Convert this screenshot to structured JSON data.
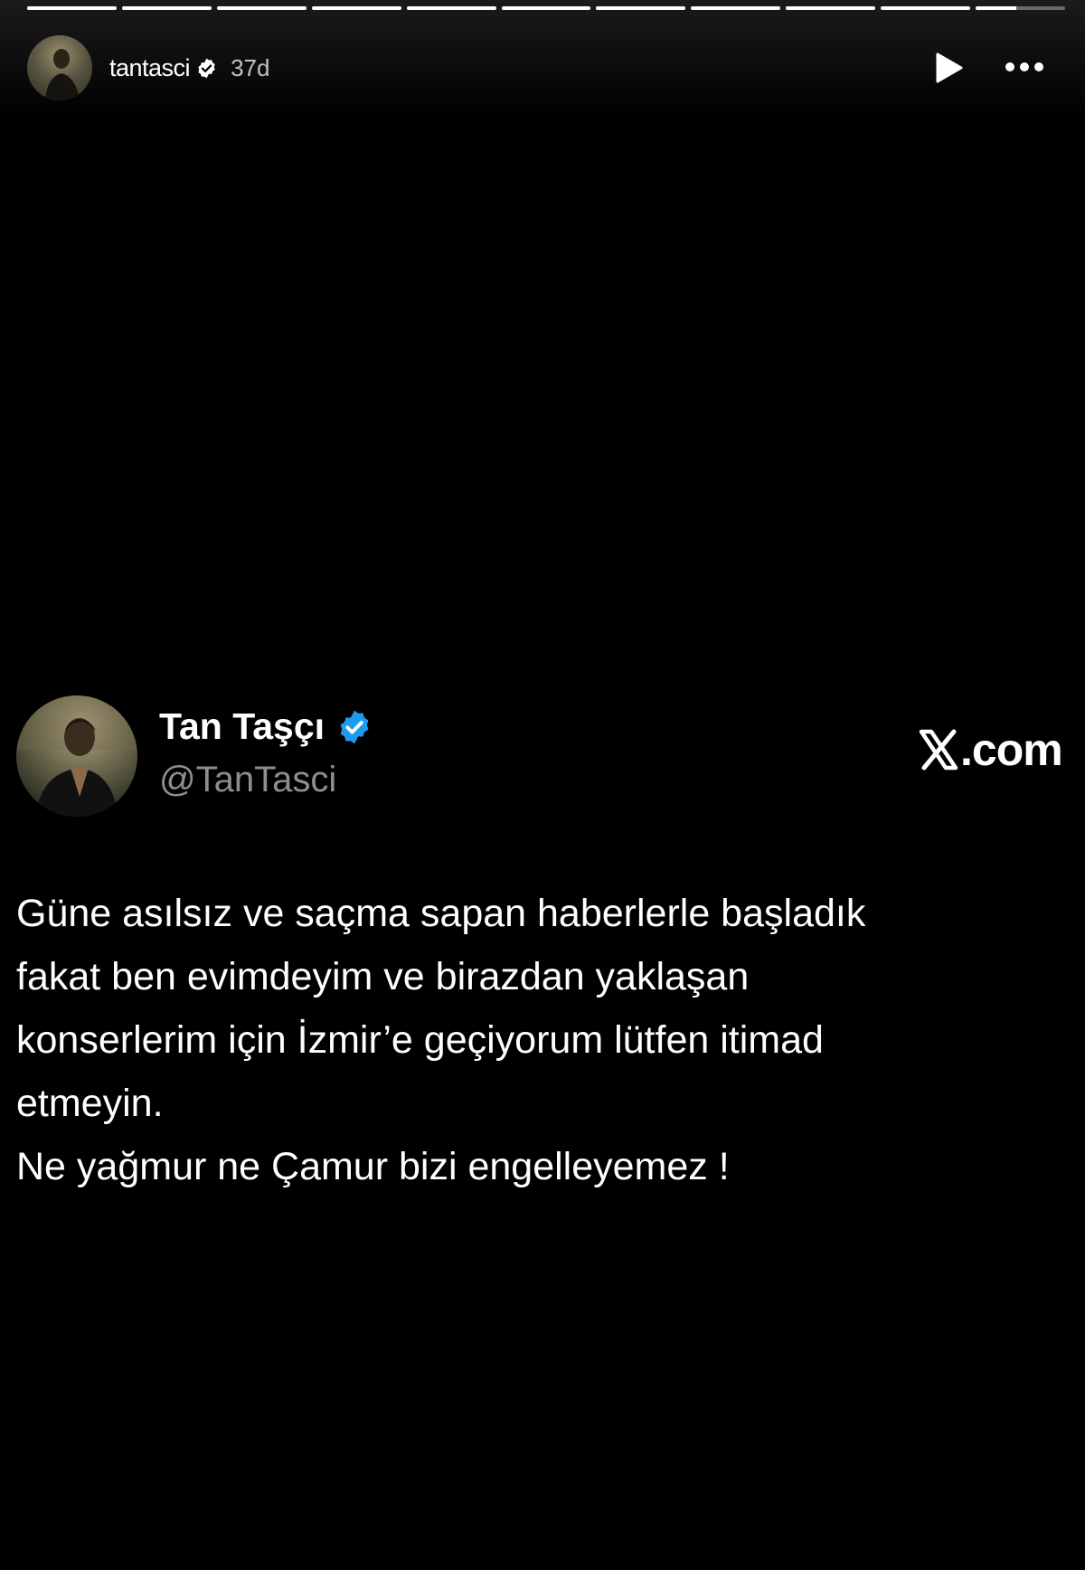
{
  "story": {
    "progress": [
      1,
      1,
      1,
      1,
      1,
      1,
      1,
      1,
      1,
      1,
      0.45
    ],
    "username": "tantasci",
    "time": "37d",
    "verified": true
  },
  "tweet": {
    "display_name": "Tan Taşçı",
    "handle": "@TanTasci",
    "source": ".com",
    "verified": true,
    "text": "Güne asılsız ve saçma sapan haberlerle başladık\nfakat ben evimdeyim ve birazdan yaklaşan\nkonserlerim için İzmir’e geçiyorum lütfen itimad\netmeyin.\nNe yağmur ne Çamur bizi engelleyemez !"
  },
  "colors": {
    "background": "#000000",
    "verified_story": "#ffffff",
    "verified_tweet": "#1d9bf0",
    "handle": "#8b8f94"
  },
  "icons": {
    "play": "play-icon",
    "more": "more-horizontal-icon",
    "verified": "verified-badge-icon",
    "x_logo": "x-logo-icon"
  }
}
